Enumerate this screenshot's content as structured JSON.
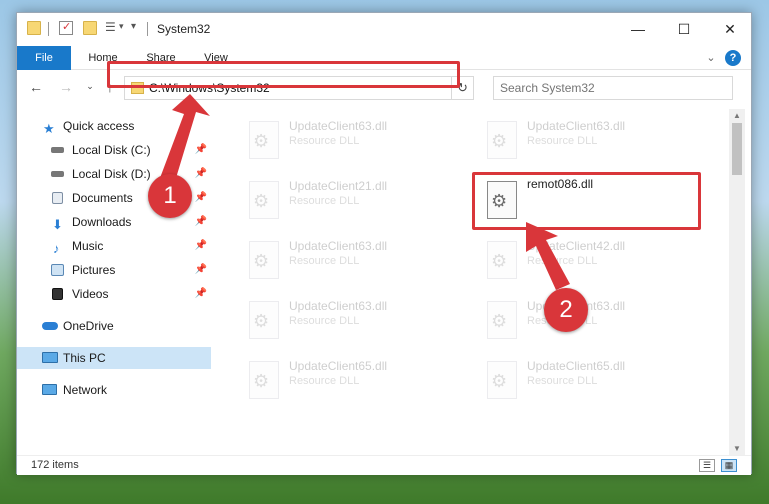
{
  "window": {
    "title": "System32",
    "controls": {
      "minimize": "—",
      "maximize": "☐",
      "close": "✕"
    }
  },
  "ribbon": {
    "tabs": [
      "File",
      "Home",
      "Share",
      "View"
    ],
    "help_icon": "?",
    "expand_icon": "⌄"
  },
  "address_bar": {
    "path": "C:\\Windows\\System32",
    "refresh_icon": "↻"
  },
  "search": {
    "placeholder": "Search System32"
  },
  "sidebar": {
    "items": [
      {
        "label": "Quick access",
        "icon": "star-icon",
        "pinned": false
      },
      {
        "label": "Local Disk (C:)",
        "icon": "drive-icon",
        "pinned": true
      },
      {
        "label": "Local Disk (D:)",
        "icon": "drive-icon",
        "pinned": true
      },
      {
        "label": "Documents",
        "icon": "document-icon",
        "pinned": true
      },
      {
        "label": "Downloads",
        "icon": "download-icon",
        "pinned": true
      },
      {
        "label": "Music",
        "icon": "music-icon",
        "pinned": true
      },
      {
        "label": "Pictures",
        "icon": "picture-icon",
        "pinned": true
      },
      {
        "label": "Videos",
        "icon": "video-icon",
        "pinned": true
      },
      {
        "label": "OneDrive",
        "icon": "cloud-icon",
        "pinned": false
      },
      {
        "label": "This PC",
        "icon": "computer-icon",
        "pinned": false,
        "selected": true
      },
      {
        "label": "Network",
        "icon": "network-icon",
        "pinned": false
      }
    ],
    "pin_glyph": "📌"
  },
  "files": [
    {
      "name": "UpdateClient63.dll",
      "type": "Resource DLL",
      "active": false
    },
    {
      "name": "UpdateClient63.dll",
      "type": "Resource DLL",
      "active": false
    },
    {
      "name": "UpdateClient21.dll",
      "type": "Resource DLL",
      "active": false
    },
    {
      "name": "remot086.dll",
      "type": "",
      "active": true
    },
    {
      "name": "UpdateClient63.dll",
      "type": "Resource DLL",
      "active": false
    },
    {
      "name": "UpdateClient42.dll",
      "type": "Resource DLL",
      "active": false
    },
    {
      "name": "UpdateClient63.dll",
      "type": "Resource DLL",
      "active": false
    },
    {
      "name": "UpdateClient63.dll",
      "type": "Resource DLL",
      "active": false
    },
    {
      "name": "UpdateClient65.dll",
      "type": "Resource DLL",
      "active": false
    },
    {
      "name": "UpdateClient65.dll",
      "type": "Resource DLL",
      "active": false
    }
  ],
  "status": {
    "item_count": "172 items"
  },
  "annotations": {
    "marker_1": "1",
    "marker_2": "2",
    "color": "#d9363a"
  }
}
